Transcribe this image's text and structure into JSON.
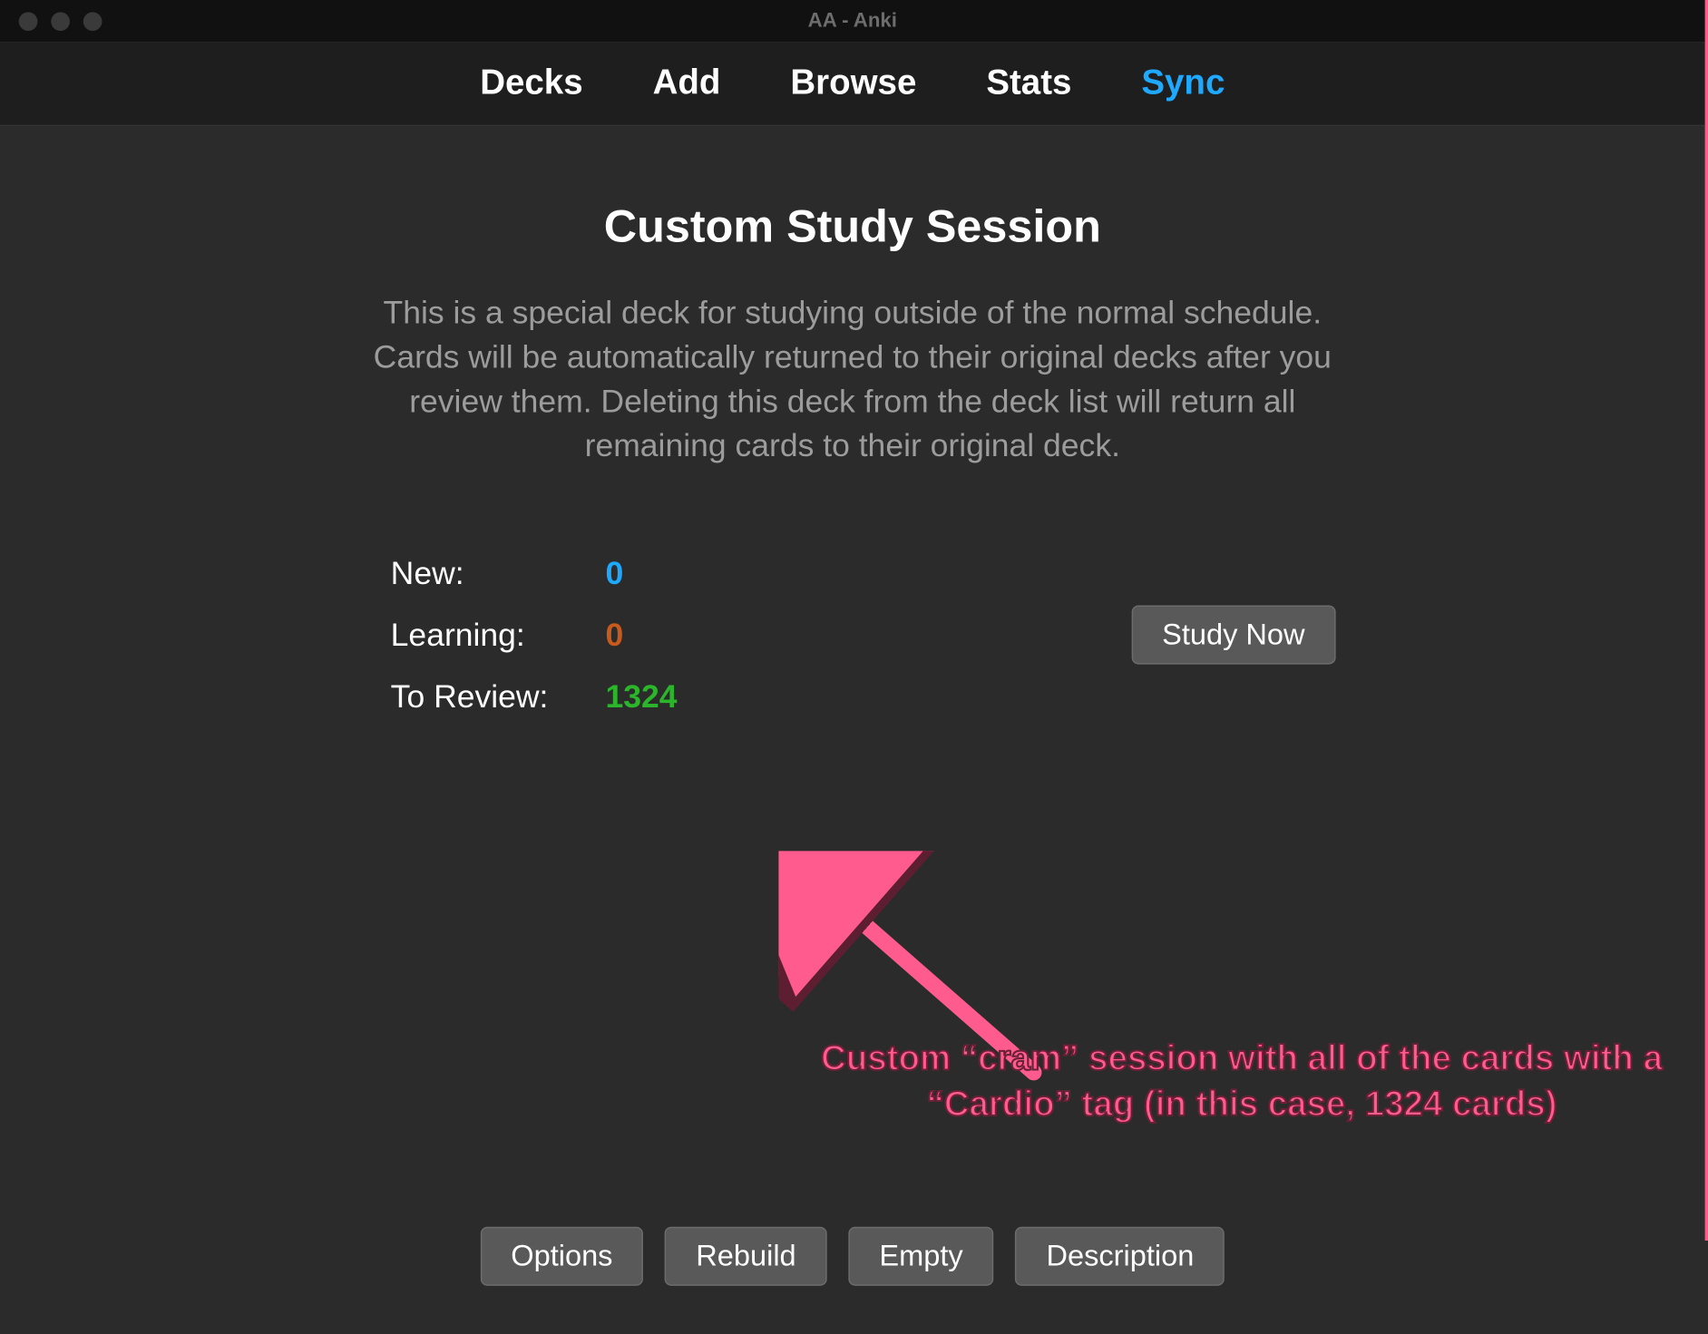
{
  "window": {
    "title": "AA - Anki"
  },
  "nav": {
    "decks": "Decks",
    "add": "Add",
    "browse": "Browse",
    "stats": "Stats",
    "sync": "Sync"
  },
  "page": {
    "title": "Custom Study Session",
    "description": "This is a special deck for studying outside of the normal schedule. Cards will be automatically returned to their original decks after you review them. Deleting this deck from the deck list will return all remaining cards to their original deck."
  },
  "stats": {
    "new_label": "New:",
    "new_value": "0",
    "learning_label": "Learning:",
    "learning_value": "0",
    "review_label": "To Review:",
    "review_value": "1324"
  },
  "buttons": {
    "study_now": "Study Now",
    "options": "Options",
    "rebuild": "Rebuild",
    "empty": "Empty",
    "description": "Description"
  },
  "annotation": {
    "text": "Custom “cram” session with all of the cards with a “Cardio” tag (in this case, 1324 cards)"
  },
  "colors": {
    "accent_sync": "#1ea9ff",
    "new": "#1ea9ff",
    "learning": "#c85a1e",
    "review": "#2bb52b",
    "annotation": "#ff5b8e"
  }
}
